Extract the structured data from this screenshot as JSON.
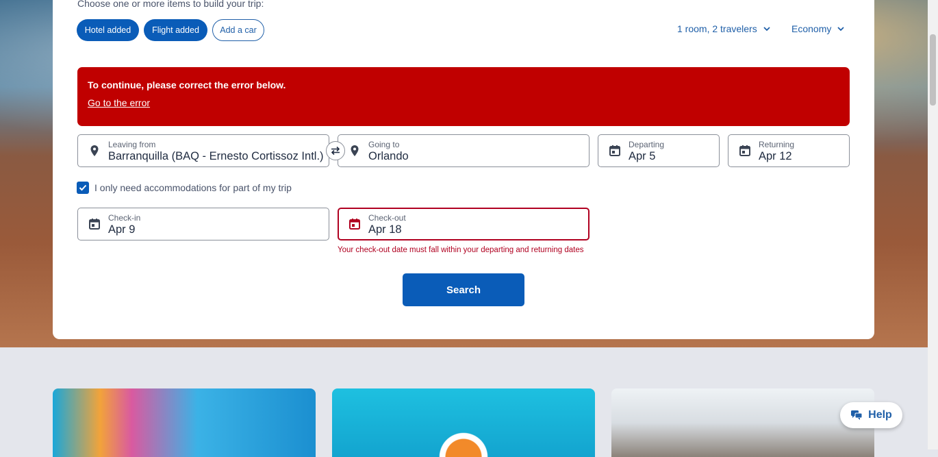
{
  "intro_text": "Choose one or more items to build your trip:",
  "pills": {
    "hotel": "Hotel added",
    "flight": "Flight added",
    "car": "Add a car"
  },
  "travelers": "1 room, 2 travelers",
  "cabin_class": "Economy",
  "error_banner": {
    "title": "To continue, please correct the error below.",
    "link": "Go to the error"
  },
  "leaving_from": {
    "label": "Leaving from",
    "value": "Barranquilla (BAQ - Ernesto Cortissoz Intl.)"
  },
  "going_to": {
    "label": "Going to",
    "value": "Orlando"
  },
  "departing": {
    "label": "Departing",
    "value": "Apr 5"
  },
  "returning": {
    "label": "Returning",
    "value": "Apr 12"
  },
  "partial_stay_label": "I only need accommodations for part of my trip",
  "check_in": {
    "label": "Check-in",
    "value": "Apr 9"
  },
  "check_out": {
    "label": "Check-out",
    "value": "Apr 18"
  },
  "checkout_error": "Your check-out date must fall within your departing and returning dates",
  "search_label": "Search",
  "help_label": "Help",
  "colors": {
    "primary": "#0a5cb8",
    "error": "#c00000"
  }
}
